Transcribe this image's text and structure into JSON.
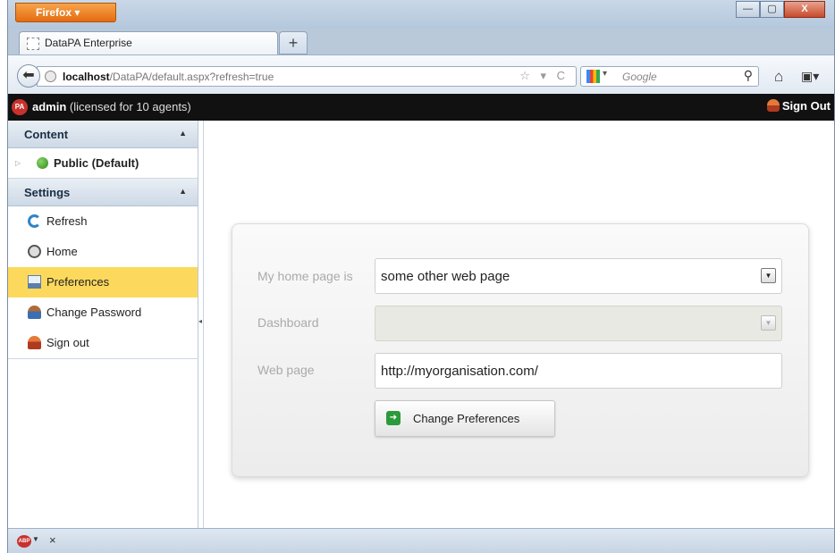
{
  "browser": {
    "menu_button": "Firefox",
    "tab_title": "DataPA Enterprise",
    "new_tab_symbol": "+",
    "url_host": "localhost",
    "url_path": "/DataPA/default.aspx?refresh=true",
    "search_placeholder": "Google",
    "window_controls": {
      "minimize": "—",
      "maximize": "▢",
      "close": "X"
    }
  },
  "app_header": {
    "logo_text": "PA",
    "user_name": "admin",
    "license_text": " (licensed for 10 agents)",
    "sign_out_label": "Sign Out"
  },
  "sidebar": {
    "content_header": "Content",
    "content_items": [
      {
        "label": "Public (Default)",
        "icon": "green-circle-icon"
      }
    ],
    "settings_header": "Settings",
    "settings_items": [
      {
        "label": "Refresh",
        "icon": "refresh-icon"
      },
      {
        "label": "Home",
        "icon": "home-icon"
      },
      {
        "label": "Preferences",
        "icon": "preferences-icon",
        "selected": true
      },
      {
        "label": "Change Password",
        "icon": "user-icon"
      },
      {
        "label": "Sign out",
        "icon": "sign-out-icon"
      }
    ]
  },
  "preferences": {
    "home_page_label": "My home page is",
    "home_page_value": "some other web page",
    "dashboard_label": "Dashboard",
    "dashboard_value": "",
    "web_page_label": "Web page",
    "web_page_value": "http://myorganisation.com/",
    "submit_label": "Change Preferences"
  },
  "statusbar": {
    "addon_label": "ABP",
    "close_symbol": "×"
  }
}
